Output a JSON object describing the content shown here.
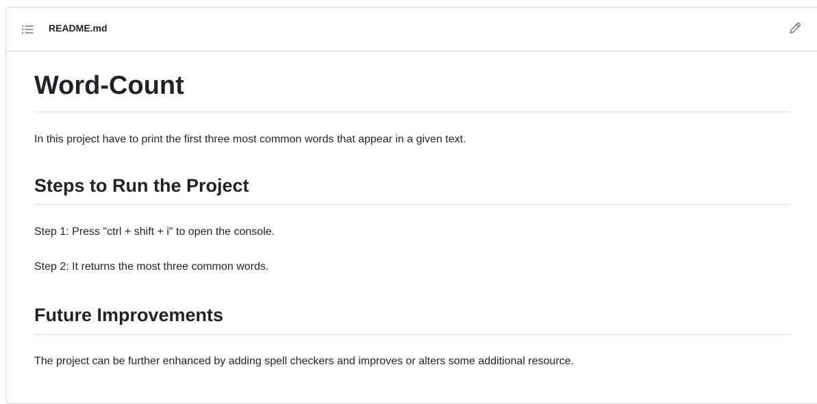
{
  "header": {
    "toc_icon": "list-unordered-icon",
    "file_name": "README.md",
    "edit_icon": "pencil-icon"
  },
  "article": {
    "title": "Word-Count",
    "intro": "In this project have to print the first three most common words that appear in a given text.",
    "steps_heading": "Steps to Run the Project",
    "step1": "Step 1: Press \"ctrl + shift + i\" to open the console.",
    "step2": "Step 2: It returns the most three common words.",
    "future_heading": "Future Improvements",
    "future_text": "The project can be further enhanced by adding spell checkers and improves or alters some additional resource."
  },
  "colors": {
    "border": "#d0d7de",
    "text": "#1f2328",
    "icon": "#636c76"
  }
}
